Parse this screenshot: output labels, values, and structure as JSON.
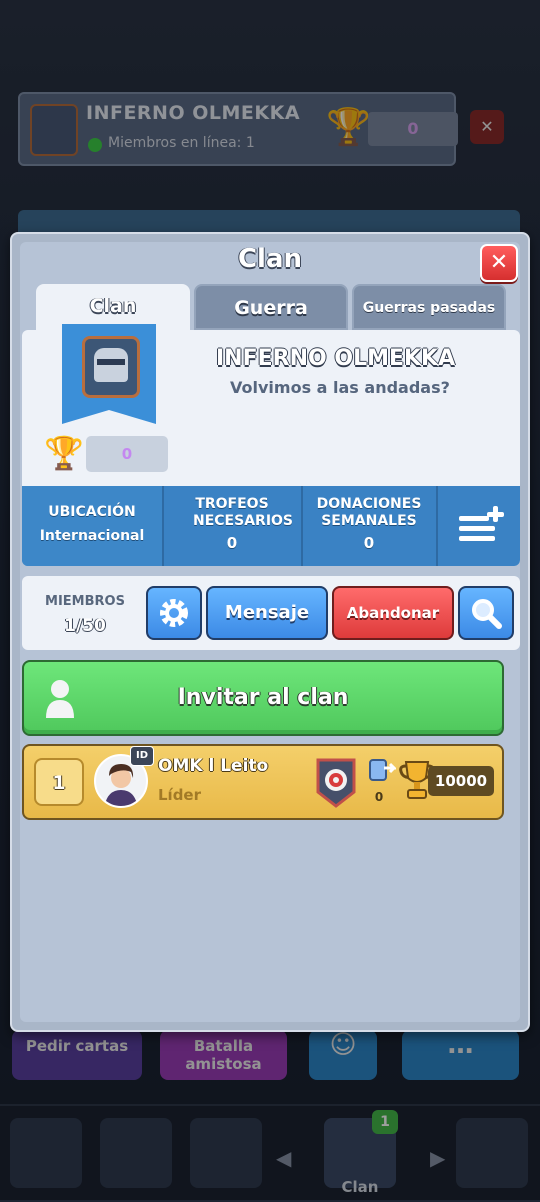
{
  "background": {
    "clan_name": "INFERNO OLMEKKA",
    "online_members": "Miembros en línea: 1",
    "trophies": "0",
    "bottom_buttons": [
      "Pedir cartas",
      "Batalla amistosa"
    ],
    "nav_clan_label": "Clan",
    "nav_clan_badge": "1"
  },
  "modal": {
    "title": "Clan",
    "close_icon": "close-icon",
    "tabs": [
      {
        "label": "Clan",
        "active": true
      },
      {
        "label": "Guerra",
        "active": false
      },
      {
        "label": "Guerras pasadas",
        "active": false
      }
    ]
  },
  "clan": {
    "name": "INFERNO OLMEKKA",
    "description": "Volvimos a las andadas?",
    "trophies": "0",
    "stats": [
      {
        "label": "UBICACIÓN",
        "value": "Internacional"
      },
      {
        "label": "TROFEOS NECESARIOS",
        "value": "0"
      },
      {
        "label": "DONACIONES SEMANALES",
        "value": "0"
      }
    ]
  },
  "members_bar": {
    "label": "MIEMBROS",
    "count": "1/50",
    "message_button": "Mensaje",
    "leave_button": "Abandonar"
  },
  "invite": {
    "label": "Invitar al clan"
  },
  "members": [
    {
      "rank": "1",
      "name": "OMK l Leito",
      "role": "Líder",
      "id_badge": "ID",
      "donations": "0",
      "trophies": "10000"
    }
  ],
  "colors": {
    "accent_blue": "#3a82c4",
    "invite_green": "#5bd868",
    "leave_red": "#de3b3b",
    "member_gold": "#e8b948"
  }
}
